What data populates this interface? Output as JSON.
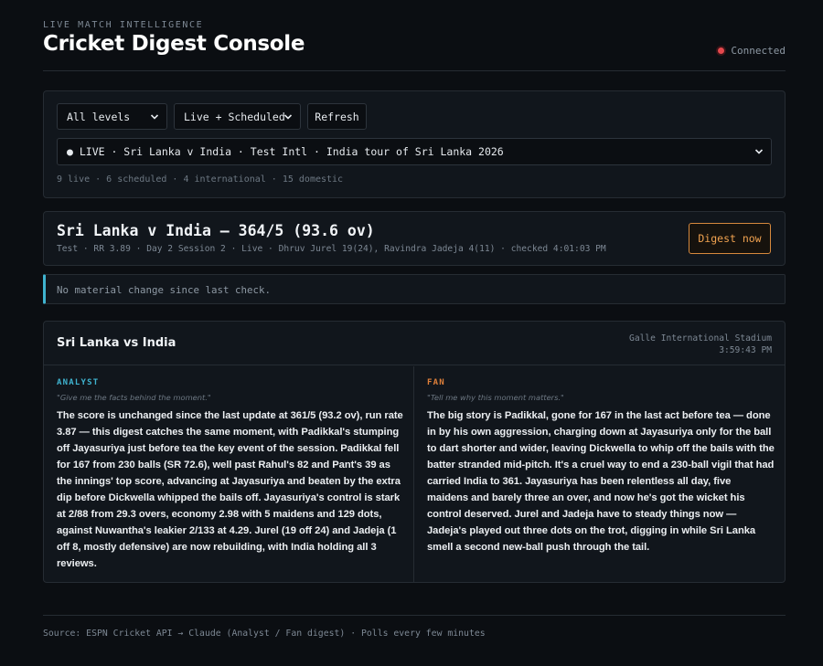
{
  "header": {
    "eyebrow": "LIVE MATCH INTELLIGENCE",
    "title": "Cricket Digest Console",
    "status": "Connected"
  },
  "filters": {
    "level_select": "All levels",
    "status_select": "Live + Scheduled",
    "refresh_label": "Refresh",
    "match_select": "● LIVE · Sri Lanka v India · Test Intl · India tour of Sri Lanka 2026",
    "counts": "9 live · 6 scheduled · 4 international · 15 domestic"
  },
  "score": {
    "headline": "Sri Lanka v India — 364/5 (93.6 ov)",
    "meta": "Test · RR 3.89 · Day 2 Session 2 · Live · Dhruv Jurel 19(24), Ravindra Jadeja 4(11) · checked 4:01:03 PM",
    "digest_label": "Digest now"
  },
  "notice": "No material change since last check.",
  "digest": {
    "title": "Sri Lanka vs India",
    "venue": "Galle International Stadium",
    "time": "3:59:43 PM",
    "analyst": {
      "role": "ANALYST",
      "prompt": "\"Give me the facts behind the moment.\"",
      "text": "The score is unchanged since the last update at 361/5 (93.2 ov), run rate 3.87 — this digest catches the same moment, with Padikkal's stumping off Jayasuriya just before tea the key event of the session. Padikkal fell for 167 from 230 balls (SR 72.6), well past Rahul's 82 and Pant's 39 as the innings' top score, advancing at Jayasuriya and beaten by the extra dip before Dickwella whipped the bails off. Jayasuriya's control is stark at 2/88 from 29.3 overs, economy 2.98 with 5 maidens and 129 dots, against Nuwantha's leakier 2/133 at 4.29. Jurel (19 off 24) and Jadeja (1 off 8, mostly defensive) are now rebuilding, with India holding all 3 reviews."
    },
    "fan": {
      "role": "FAN",
      "prompt": "\"Tell me why this moment matters.\"",
      "text": "The big story is Padikkal, gone for 167 in the last act before tea — done in by his own aggression, charging down at Jayasuriya only for the ball to dart shorter and wider, leaving Dickwella to whip off the bails with the batter stranded mid-pitch. It's a cruel way to end a 230-ball vigil that had carried India to 361. Jayasuriya has been relentless all day, five maidens and barely three an over, and now he's got the wicket his control deserved. Jurel and Jadeja have to steady things now — Jadeja's played out three dots on the trot, digging in while Sri Lanka smell a second new-ball push through the tail."
    }
  },
  "footer": "Source: ESPN Cricket API → Claude (Analyst / Fan digest) · Polls every few minutes",
  "colors": {
    "background": "#0b0e12",
    "panel": "#11161c",
    "accent_analyst": "#3fb3cf",
    "accent_fan": "#e0803a",
    "status_red": "#e5484d"
  }
}
